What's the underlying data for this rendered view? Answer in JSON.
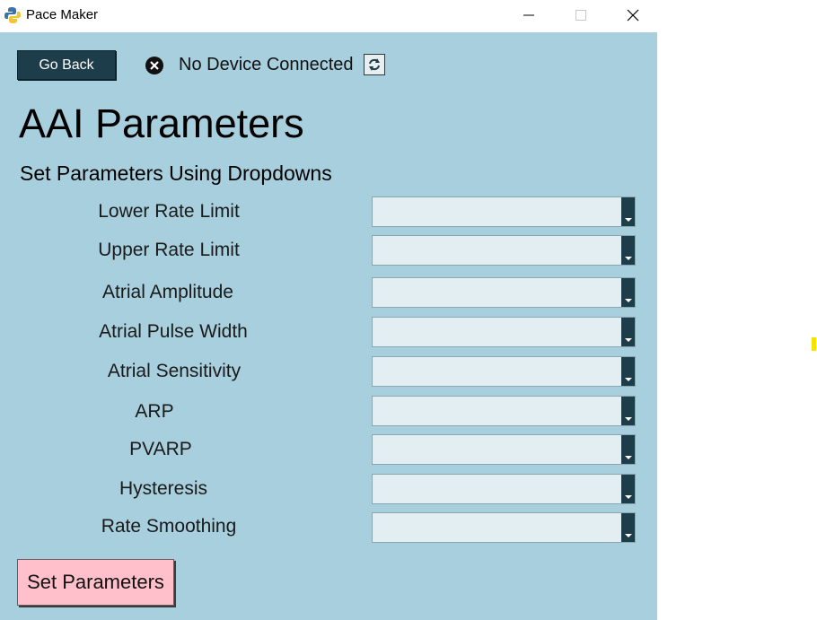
{
  "window": {
    "title": "Pace Maker"
  },
  "header": {
    "go_back_label": "Go Back",
    "status_text": "No Device Connected"
  },
  "page": {
    "title": "AAI Parameters",
    "subtitle": "Set Parameters Using Dropdowns"
  },
  "params": [
    {
      "label": "Lower Rate Limit",
      "value": ""
    },
    {
      "label": "Upper Rate Limit",
      "value": ""
    },
    {
      "label": "Atrial Amplitude",
      "value": ""
    },
    {
      "label": "Atrial Pulse Width",
      "value": ""
    },
    {
      "label": "Atrial Sensitivity",
      "value": ""
    },
    {
      "label": "ARP",
      "value": ""
    },
    {
      "label": "PVARP",
      "value": ""
    },
    {
      "label": "Hysteresis",
      "value": ""
    },
    {
      "label": "Rate Smoothing",
      "value": ""
    }
  ],
  "footer": {
    "set_button_label": "Set Parameters"
  },
  "colors": {
    "background": "#a8cfdd",
    "go_back_button": "#1e3d4a",
    "set_button": "#ffc0cb",
    "dropdown": "#e2eef2"
  }
}
